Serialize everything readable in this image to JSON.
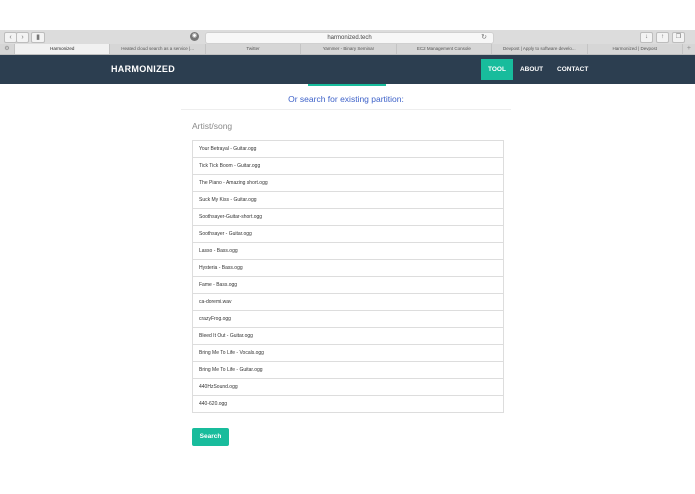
{
  "browser": {
    "address": "harmonized.tech",
    "tabs": [
      {
        "label": "Harmonized",
        "active": true
      },
      {
        "label": "Heated cloud search as a service |...",
        "active": false
      },
      {
        "label": "Twitter",
        "active": false
      },
      {
        "label": "Yammer - Binary Seminar",
        "active": false
      },
      {
        "label": "EC2 Management Console",
        "active": false
      },
      {
        "label": "Devpost | Apply to software develo...",
        "active": false
      },
      {
        "label": "Harmonized | Devpost",
        "active": false
      }
    ]
  },
  "site": {
    "brand": "HARMONIZED",
    "menu": [
      {
        "label": "TOOL",
        "active": true
      },
      {
        "label": "ABOUT",
        "active": false
      },
      {
        "label": "CONTACT",
        "active": false
      }
    ]
  },
  "main": {
    "subtitle": "Or search for existing partition:",
    "artist_placeholder": "Artist/song",
    "partitions": [
      "Your Betrayal - Guitar.ogg",
      "Tick Tick Boom - Guitar.ogg",
      "The Piano - Amazing short.ogg",
      "Suck My Kiss - Guitar.ogg",
      "Soothsayer-Guitar-short.ogg",
      "Soothsayer - Guitar.ogg",
      "Lasso - Bass.ogg",
      "Hysteria - Bass.ogg",
      "Fame - Bass.ogg",
      "ca-doremi.wav",
      "crazyFrog.ogg",
      "Bleed It Out - Guitar.ogg",
      "Bring Me To Life - Vocals.ogg",
      "Bring Me To Life - Guitar.ogg",
      "440HzSound.ogg",
      "440-620.ogg"
    ],
    "search_label": "Search"
  },
  "colors": {
    "navbar": "#2c3e50",
    "accent": "#18bc9c",
    "subtitle": "#3e62c9"
  }
}
